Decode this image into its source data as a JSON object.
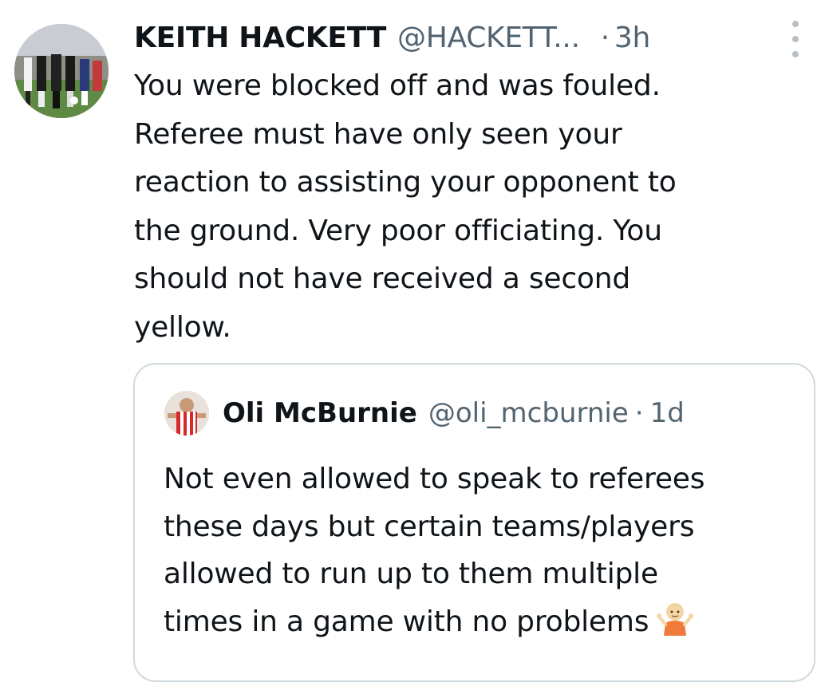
{
  "tweet": {
    "author_name": "KEITH HACKETT",
    "author_handle": "@HACKETT...",
    "separator": "·",
    "time": "3h",
    "text_lines": [
      "You were blocked off and was fouled.",
      "Referee must have only seen your",
      "reaction to assisting your opponent to",
      "the ground. Very poor officiating. You",
      "should not have received a second",
      "yellow."
    ]
  },
  "quoted_tweet": {
    "author_name": "Oli McBurnie",
    "author_handle": "@oli_mcburnie",
    "separator": "·",
    "time": "1d",
    "text_lines": [
      "Not even allowed to speak to referees",
      "these days but certain teams/players",
      "allowed to run up to them multiple",
      "times in a game with no problems"
    ],
    "emoji": "shrugging-person-emoji"
  },
  "colors": {
    "text_primary": "#0f1419",
    "text_secondary": "#536471",
    "border": "#cfd9de",
    "more_dots": "#b7c0c7"
  }
}
